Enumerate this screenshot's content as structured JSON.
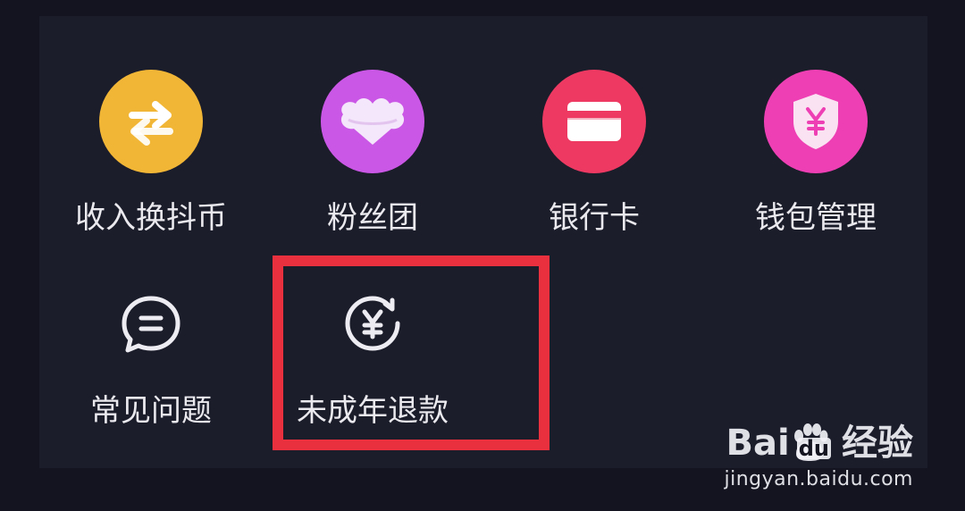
{
  "menu": {
    "row1": [
      {
        "label": "收入换抖币",
        "icon": "exchange-icon",
        "color": "#f2b637"
      },
      {
        "label": "粉丝团",
        "icon": "cloud-heart-icon",
        "color": "#cb57e6"
      },
      {
        "label": "银行卡",
        "icon": "bank-card-icon",
        "color": "#ee3a63"
      },
      {
        "label": "钱包管理",
        "icon": "shield-yuan-icon",
        "color": "#ee40b4"
      }
    ],
    "row2": [
      {
        "label": "常见问题",
        "icon": "chat-bubble-icon"
      },
      {
        "label": "未成年退款",
        "icon": "yuan-refund-icon"
      }
    ]
  },
  "highlight_color": "#e8303f",
  "watermark": {
    "brand_a": "Bai",
    "brand_b": "du",
    "suffix": "经验",
    "url": "jingyan.baidu.com"
  }
}
